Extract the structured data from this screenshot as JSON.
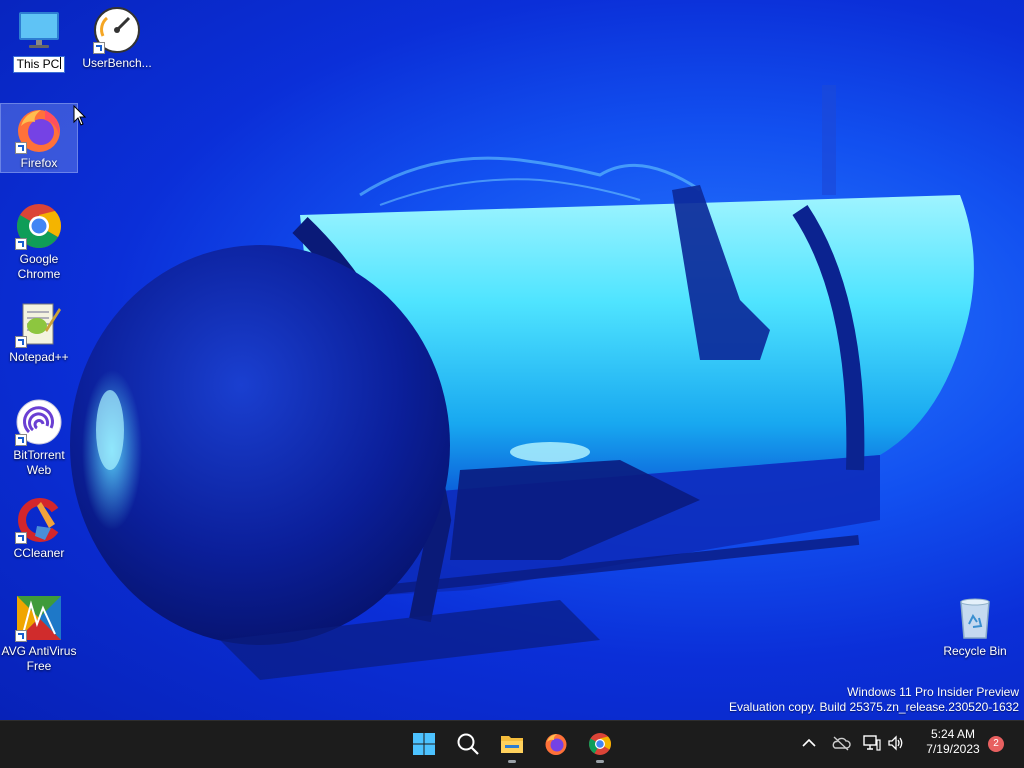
{
  "desktop_icons": [
    {
      "name": "this-pc",
      "label": "This PC",
      "renaming": true,
      "shortcut": false
    },
    {
      "name": "userbenchmark",
      "label": "UserBench...",
      "shortcut": true
    },
    {
      "name": "firefox",
      "label": "Firefox",
      "shortcut": true,
      "selected": true
    },
    {
      "name": "google-chrome",
      "label": "Google Chrome",
      "shortcut": true
    },
    {
      "name": "notepad-plus-plus",
      "label": "Notepad++",
      "shortcut": true
    },
    {
      "name": "bittorrent-web",
      "label": "BitTorrent Web",
      "shortcut": true
    },
    {
      "name": "ccleaner",
      "label": "CCleaner",
      "shortcut": true
    },
    {
      "name": "avg-antivirus-free",
      "label": "AVG AntiVirus Free",
      "shortcut": true
    },
    {
      "name": "recycle-bin",
      "label": "Recycle Bin",
      "shortcut": false
    }
  ],
  "watermark": {
    "line1": "Windows 11 Pro Insider Preview",
    "line2": "Evaluation copy. Build 25375.zn_release.230520-1632"
  },
  "taskbar": {
    "apps": [
      {
        "name": "start",
        "icon": "windows-logo-icon",
        "running": false
      },
      {
        "name": "search",
        "icon": "search-icon",
        "running": false
      },
      {
        "name": "file-explorer",
        "icon": "folder-icon",
        "running": true
      },
      {
        "name": "firefox",
        "icon": "firefox-icon",
        "running": false
      },
      {
        "name": "chrome",
        "icon": "chrome-icon",
        "running": true
      }
    ],
    "tray_icons": [
      "chevron-up-icon",
      "onedrive-icon",
      "network-icon",
      "volume-icon"
    ],
    "clock": {
      "time": "5:24 AM",
      "date": "7/19/2023"
    },
    "notification_count": "2"
  },
  "colors": {
    "wallpaper_deep": "#0722b8",
    "wallpaper_light": "#2a7cff",
    "taskbar": "#1c1c1c",
    "badge": "#e86060"
  }
}
